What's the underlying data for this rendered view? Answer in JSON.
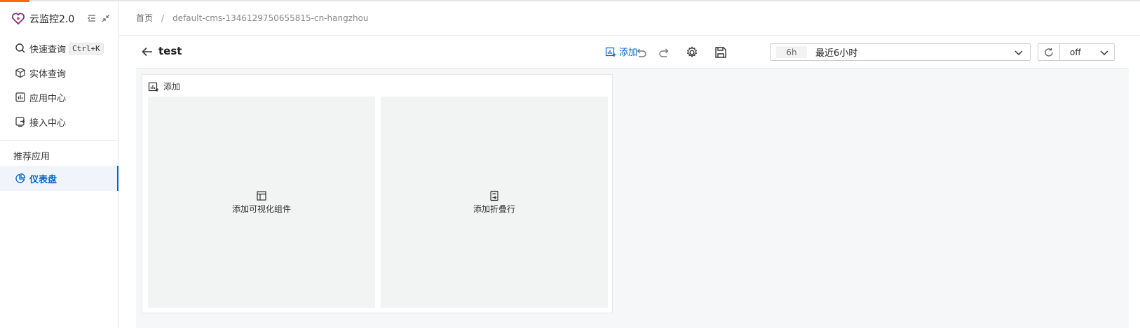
{
  "sidebar": {
    "brand": "云监控2.0",
    "items": [
      {
        "label": "快速查询",
        "kbd": "Ctrl+K"
      },
      {
        "label": "实体查询"
      },
      {
        "label": "应用中心"
      },
      {
        "label": "接入中心"
      }
    ],
    "section_label": "推荐应用",
    "active_item": {
      "label": "仪表盘"
    }
  },
  "header": {
    "breadcrumb": [
      "首页",
      "default-cms-1346129750655815-cn-hangzhou"
    ]
  },
  "toolbar": {
    "title": "test",
    "add_label": "添加",
    "time": {
      "tag": "6h",
      "value": "最近6小时"
    },
    "refresh": "off"
  },
  "canvas": {
    "card_title": "添加",
    "options": [
      {
        "label": "添加可视化组件"
      },
      {
        "label": "添加折叠行"
      }
    ]
  },
  "colors": {
    "accent": "#0064c8",
    "brand_top": "#ff6a00"
  }
}
